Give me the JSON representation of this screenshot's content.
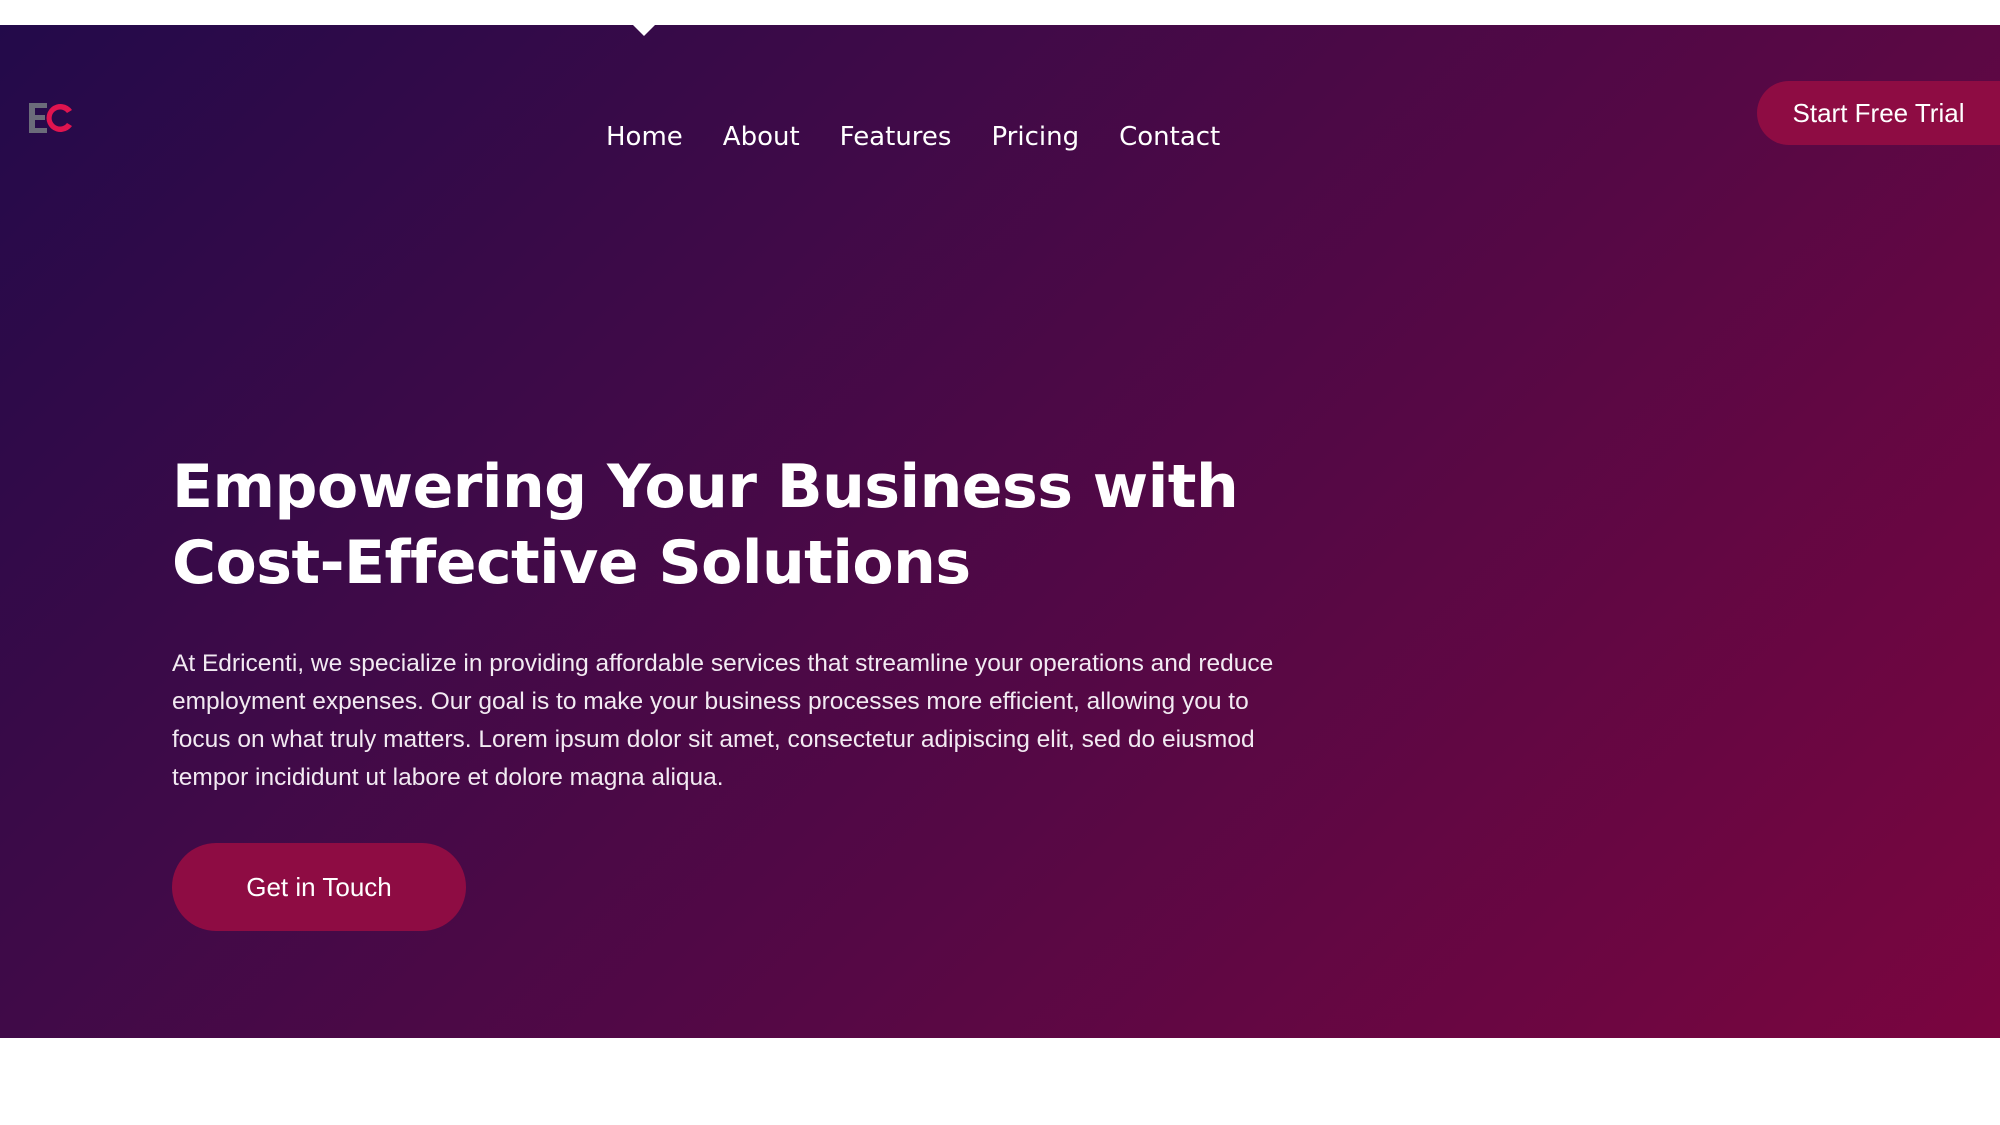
{
  "brand": {
    "logo_text": "EC",
    "logo_icon": "ec-logo-icon",
    "colors": {
      "e_letter": "#6b6b7a",
      "c_letter": "#e0144f"
    }
  },
  "nav": {
    "items": [
      {
        "label": "Home"
      },
      {
        "label": "About"
      },
      {
        "label": "Features"
      },
      {
        "label": "Pricing"
      },
      {
        "label": "Contact"
      }
    ],
    "cta_label": "Start Free Trial"
  },
  "hero": {
    "headline_line1": "Empowering Your Business with",
    "headline_line2": "Cost-Effective Solutions",
    "description": "At Edricenti, we specialize in providing affordable services that streamline your operations and reduce employment expenses. Our goal is to make your business processes more efficient, allowing you to focus on what truly matters. Lorem ipsum dolor sit amet, consectetur adipiscing elit, sed do eiusmod tempor incididunt ut labore et dolore magna aliqua.",
    "cta_label": "Get in Touch"
  },
  "theme": {
    "gradient_start": "#230a4a",
    "gradient_end": "#7a053f",
    "button_color": "#8e0c43",
    "text_color": "#ffffff"
  }
}
